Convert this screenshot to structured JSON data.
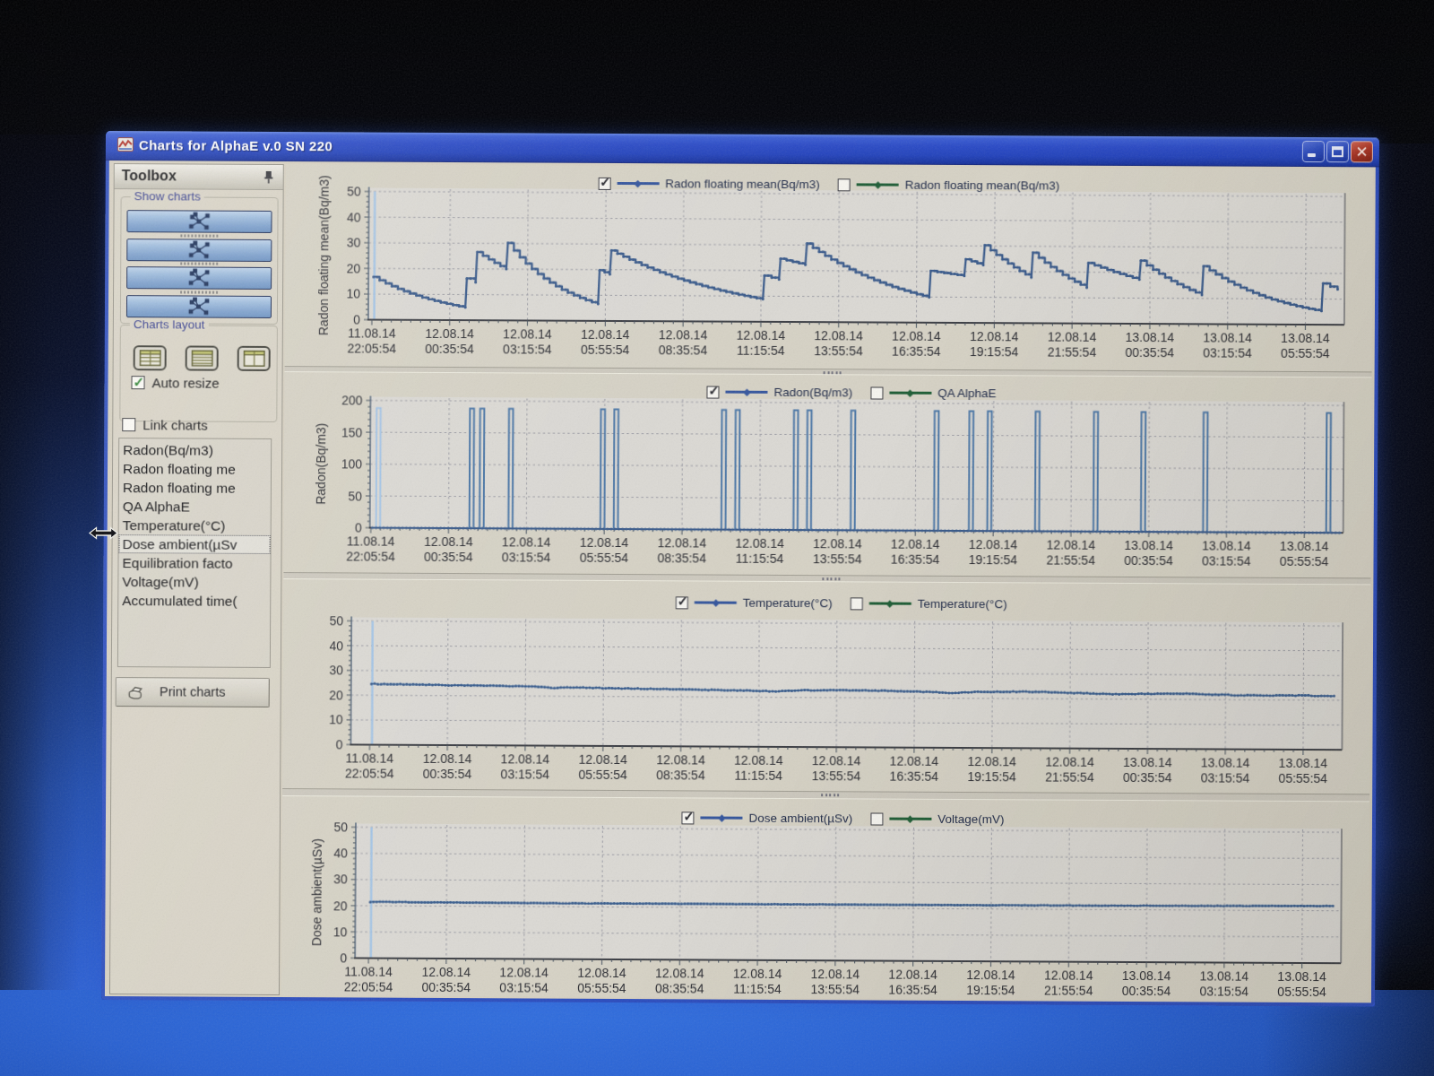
{
  "window": {
    "title": "Charts for AlphaE v.0 SN 220",
    "buttons": {
      "minimize": "minimize",
      "maximize": "maximize",
      "close": "close"
    }
  },
  "toolbox": {
    "title": "Toolbox",
    "pin_icon": "pin-icon",
    "show_charts_group": {
      "title": "Show charts",
      "buttons": [
        {
          "icon": "scatter-chart-icon"
        },
        {
          "icon": "scatter-chart-icon"
        },
        {
          "icon": "scatter-chart-icon"
        },
        {
          "icon": "scatter-chart-icon"
        }
      ]
    },
    "charts_layout_group": {
      "title": "Charts layout",
      "buttons": [
        {
          "icon": "layout-grid-icon"
        },
        {
          "icon": "layout-rows-icon"
        },
        {
          "icon": "layout-columns-icon"
        }
      ],
      "auto_resize": {
        "label": "Auto resize",
        "checked": true
      }
    },
    "link_charts": {
      "label": "Link charts",
      "checked": false
    },
    "list": {
      "items": [
        {
          "label": "Radon(Bq/m3)",
          "selected": false
        },
        {
          "label": "Radon floating me",
          "selected": false
        },
        {
          "label": "Radon floating me",
          "selected": false
        },
        {
          "label": "QA AlphaE",
          "selected": false
        },
        {
          "label": "Temperature(°C)",
          "selected": false
        },
        {
          "label": "Dose ambient(µSv",
          "selected": true
        },
        {
          "label": "Equilibration facto",
          "selected": false
        },
        {
          "label": "Voltage(mV)",
          "selected": false
        },
        {
          "label": "Accumulated time(",
          "selected": false
        }
      ]
    },
    "print_button": {
      "label": "Print charts",
      "icon": "printer-icon"
    }
  },
  "colors": {
    "series_blue": "#38598a",
    "series_light_blue": "#a3c4e6",
    "series_green": "#1d5c34",
    "plot_bg": "#dbd9d4",
    "grid": "#9d9da5",
    "axis_dark": "#3a3c42",
    "axis_left": "#5d6e80",
    "titlebar_blue": "#2a4ac6",
    "close_red": "#ad3423",
    "desktop_blue": "#2458c4"
  },
  "chart_data": {
    "type": "line",
    "x_axis_label_columns": [
      [
        "11.08.14",
        "22:05:54"
      ],
      [
        "12.08.14",
        "00:35:54"
      ],
      [
        "12.08.14",
        "03:15:54"
      ],
      [
        "12.08.14",
        "05:55:54"
      ],
      [
        "12.08.14",
        "08:35:54"
      ],
      [
        "12.08.14",
        "11:15:54"
      ],
      [
        "12.08.14",
        "13:55:54"
      ],
      [
        "12.08.14",
        "16:35:54"
      ],
      [
        "12.08.14",
        "19:15:54"
      ],
      [
        "12.08.14",
        "21:55:54"
      ],
      [
        "13.08.14",
        "00:35:54"
      ],
      [
        "13.08.14",
        "03:15:54"
      ],
      [
        "13.08.14",
        "05:55:54"
      ]
    ],
    "hours_between_labels": 2.6667,
    "charts": [
      {
        "name": "radon-floating-mean",
        "ylabel": "Radon floating mean(Bq/m3)",
        "ylim": [
          0,
          50
        ],
        "yticks": [
          0,
          10,
          20,
          30,
          40,
          50
        ],
        "legend": [
          {
            "label": "Radon floating mean(Bq/m3)",
            "checked": true,
            "color": "blue"
          },
          {
            "label": "Radon floating mean(Bq/m3)",
            "checked": false,
            "color": "green"
          }
        ],
        "series_style": "staircase",
        "start_spike": true,
        "anchors": [
          [
            0.05,
            16.7
          ],
          [
            3.2,
            5.0
          ],
          [
            3.25,
            16.3
          ],
          [
            3.55,
            14.8
          ],
          [
            3.6,
            26.6
          ],
          [
            4.6,
            20.0
          ],
          [
            4.65,
            30.2
          ],
          [
            7.75,
            6.6
          ],
          [
            7.8,
            19.8
          ],
          [
            8.15,
            18.2
          ],
          [
            8.2,
            27.5
          ],
          [
            13.4,
            8.8
          ],
          [
            13.45,
            18.0
          ],
          [
            13.95,
            16.5
          ],
          [
            14.0,
            24.6
          ],
          [
            14.85,
            22.3
          ],
          [
            14.9,
            30.6
          ],
          [
            19.1,
            9.9
          ],
          [
            19.15,
            20.2
          ],
          [
            20.3,
            18.3
          ],
          [
            20.35,
            24.8
          ],
          [
            20.95,
            22.5
          ],
          [
            21.0,
            30.3
          ],
          [
            22.6,
            17.8
          ],
          [
            22.65,
            27.5
          ],
          [
            24.5,
            14.0
          ],
          [
            24.55,
            23.6
          ],
          [
            26.3,
            17.2
          ],
          [
            26.35,
            24.6
          ],
          [
            28.45,
            11.4
          ],
          [
            28.5,
            22.6
          ],
          [
            32.55,
            5.3
          ],
          [
            32.6,
            16.1
          ],
          [
            33.1,
            13.8
          ]
        ]
      },
      {
        "name": "radon",
        "ylabel": "Radon(Bq/m3)",
        "ylim": [
          0,
          200
        ],
        "yticks": [
          0,
          50,
          100,
          150,
          200
        ],
        "legend": [
          {
            "label": "Radon(Bq/m3)",
            "checked": true,
            "color": "blue"
          },
          {
            "label": "QA AlphaE",
            "checked": false,
            "color": "green"
          }
        ],
        "series_style": "pulses",
        "baseline": 0,
        "pulse_height": 188,
        "pulse_width_hours": 0.14,
        "pulse_times": [
          0.25,
          3.45,
          3.8,
          4.79,
          7.94,
          8.4,
          12.09,
          12.56,
          14.56,
          15.02,
          16.52,
          19.38,
          20.57,
          21.2,
          22.84,
          24.84,
          26.47,
          28.6,
          32.82
        ]
      },
      {
        "name": "temperature",
        "ylabel": "",
        "ylim": [
          0,
          50
        ],
        "yticks": [
          0,
          10,
          20,
          30,
          40,
          50
        ],
        "legend": [
          {
            "label": "Temperature(°C)",
            "checked": true,
            "color": "blue"
          },
          {
            "label": "Temperature(°C)",
            "checked": false,
            "color": "green"
          }
        ],
        "series_style": "noisy",
        "start_spike": true,
        "noise": 0.14,
        "anchors": [
          [
            0.05,
            24.6
          ],
          [
            1.5,
            24.4
          ],
          [
            3,
            24.2
          ],
          [
            4.5,
            24.1
          ],
          [
            5.5,
            23.9
          ],
          [
            6.3,
            23.4
          ],
          [
            7,
            23.6
          ],
          [
            8.5,
            23.3
          ],
          [
            10,
            23.1
          ],
          [
            11.5,
            22.9
          ],
          [
            13,
            22.7
          ],
          [
            14,
            22.4
          ],
          [
            14.6,
            22.9
          ],
          [
            16,
            23.0
          ],
          [
            17.5,
            22.9
          ],
          [
            19,
            22.6
          ],
          [
            20,
            22.2
          ],
          [
            21,
            22.7
          ],
          [
            22.5,
            22.8
          ],
          [
            24,
            22.5
          ],
          [
            25.5,
            22.0
          ],
          [
            26.5,
            22.2
          ],
          [
            28,
            22.3
          ],
          [
            29.5,
            21.9
          ],
          [
            31,
            21.8
          ],
          [
            32,
            21.9
          ],
          [
            33.1,
            21.6
          ]
        ]
      },
      {
        "name": "dose-ambient",
        "ylabel": "Dose ambient(µSv)",
        "ylim": [
          0,
          50
        ],
        "yticks": [
          0,
          10,
          20,
          30,
          40,
          50
        ],
        "legend": [
          {
            "label": "Dose ambient(µSv)",
            "checked": true,
            "color": "blue"
          },
          {
            "label": "Voltage(mV)",
            "checked": false,
            "color": "green"
          }
        ],
        "series_style": "noisy",
        "start_spike": true,
        "noise": 0.07,
        "anchors": [
          [
            0.05,
            21.5
          ],
          [
            4,
            21.4
          ],
          [
            8,
            21.35
          ],
          [
            12,
            21.4
          ],
          [
            16,
            21.4
          ],
          [
            20,
            21.45
          ],
          [
            24,
            21.5
          ],
          [
            28,
            21.6
          ],
          [
            31,
            21.75
          ],
          [
            33.1,
            21.85
          ]
        ]
      }
    ]
  }
}
